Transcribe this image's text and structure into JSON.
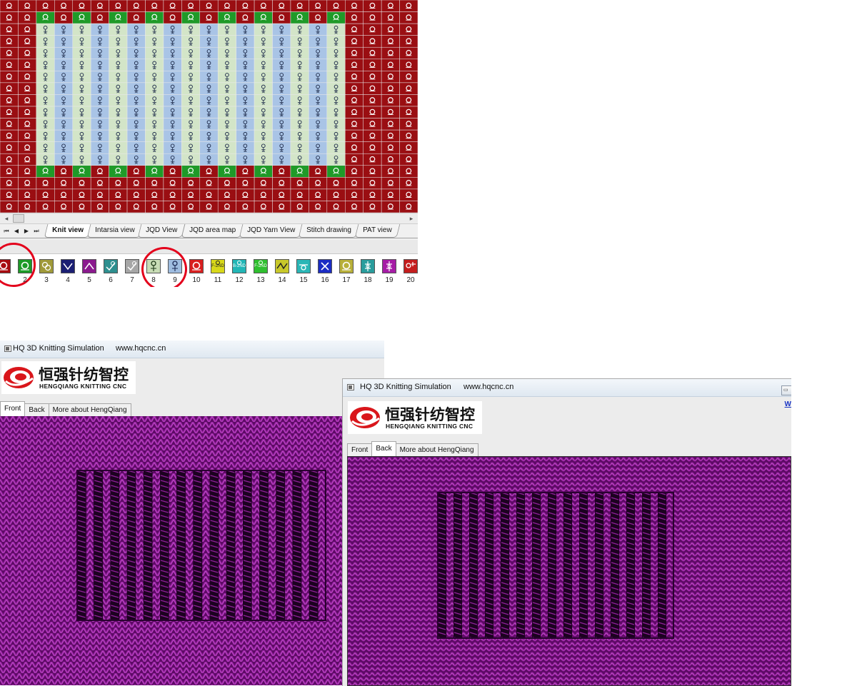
{
  "colors": {
    "red_bg": "#9a0e12",
    "green_bg": "#1f9a28",
    "lightgreen_col": "#d3e5c8",
    "lightblue_col": "#a9c4e6",
    "knit_purple": "#7a0f82",
    "ring_red": "#e3001b",
    "link_blue": "#1a35c4"
  },
  "pattern": {
    "cols": 23,
    "rows": 18,
    "inner_cols": 20,
    "inner_rows": 14,
    "icons": [
      "knit-loop-icon",
      "tuck-loop-icon",
      "transfer-icon"
    ]
  },
  "editor": {
    "sheet_nav": [
      "⏮",
      "◀",
      "▶",
      "⏭"
    ],
    "sheet_tabs": [
      {
        "label": "Knit view",
        "active": true
      },
      {
        "label": "Intarsia view",
        "active": false
      },
      {
        "label": "JQD View",
        "active": false
      },
      {
        "label": "JQD area map",
        "active": false
      },
      {
        "label": "JQD Yarn View",
        "active": false
      },
      {
        "label": "Stitch drawing",
        "active": false
      },
      {
        "label": "PAT view",
        "active": false
      }
    ],
    "palette": [
      {
        "num": "",
        "color": "#a80c10",
        "icon": "loop-knit-icon",
        "fg": "#ffffff",
        "circled": true
      },
      {
        "num": "2",
        "color": "#1d9a27",
        "icon": "loop-tuck-icon",
        "fg": "#ffffff",
        "circled": true
      },
      {
        "num": "3",
        "color": "#a09a3a",
        "icon": "double-loop-icon",
        "fg": "#ffffff",
        "circled": false
      },
      {
        "num": "4",
        "color": "#1b1f73",
        "icon": "v-stitch-icon",
        "fg": "#ffffff",
        "circled": false
      },
      {
        "num": "5",
        "color": "#8b1a8e",
        "icon": "caret-stitch-icon",
        "fg": "#ffffff",
        "circled": false
      },
      {
        "num": "6",
        "color": "#2e8f8f",
        "icon": "loop-up-icon",
        "fg": "#ffffff",
        "circled": false
      },
      {
        "num": "7",
        "color": "#a6a6a6",
        "icon": "tick-stitch-icon",
        "fg": "#ffffff",
        "circled": false
      },
      {
        "num": "8",
        "color": "#c8ddb6",
        "icon": "transfer-front-icon",
        "fg": "#1d3a18",
        "circled": true
      },
      {
        "num": "9",
        "color": "#9fbde0",
        "icon": "transfer-back-icon",
        "fg": "#1c2a55",
        "circled": true
      },
      {
        "num": "10",
        "color": "#d81f1f",
        "icon": "loop-red-icon",
        "fg": "#ffffff",
        "circled": false
      },
      {
        "num": "11",
        "color": "#d8d81a",
        "icon": "f2nd-icon",
        "fg": "#222222",
        "circled": false,
        "text": "F-2ND"
      },
      {
        "num": "12",
        "color": "#22b6b6",
        "icon": "b2nd-icon",
        "fg": "#ffffff",
        "circled": false,
        "text": "B-2ND"
      },
      {
        "num": "13",
        "color": "#2fbf2f",
        "icon": "f2nd-green-icon",
        "fg": "#ffffff",
        "circled": false,
        "text": "F-2ND"
      },
      {
        "num": "14",
        "color": "#c8c82a",
        "icon": "zigzag-icon",
        "fg": "#222222",
        "circled": false
      },
      {
        "num": "15",
        "color": "#2ab6b6",
        "icon": "tuck-bar-icon",
        "fg": "#ffffff",
        "circled": false
      },
      {
        "num": "16",
        "color": "#1b2cc4",
        "icon": "cross-icon",
        "fg": "#ffffff",
        "circled": false
      },
      {
        "num": "17",
        "color": "#b8b03a",
        "icon": "loop-olive-icon",
        "fg": "#ffffff",
        "circled": false
      },
      {
        "num": "18",
        "color": "#2a9d9d",
        "icon": "split-stitch-icon",
        "fg": "#ffffff",
        "circled": false
      },
      {
        "num": "19",
        "color": "#a61ca6",
        "icon": "split-magenta-icon",
        "fg": "#ffffff",
        "circled": false
      },
      {
        "num": "20",
        "color": "#c41d1d",
        "icon": "move-red-icon",
        "fg": "#ffffff",
        "circled": false
      }
    ]
  },
  "sim_front": {
    "title": "HQ 3D Knitting Simulation",
    "url": "www.hqcnc.cn",
    "logo_cn": "恒强针纺智控",
    "logo_en": "HENGQIANG KNITTING CNC",
    "tabs": [
      {
        "label": "Front",
        "active": true
      },
      {
        "label": "Back",
        "active": false
      },
      {
        "label": "More about HengQiang",
        "active": false
      }
    ],
    "ribs": 15
  },
  "sim_back": {
    "title": "HQ 3D Knitting Simulation",
    "url": "www.hqcnc.cn",
    "logo_cn": "恒强针纺智控",
    "logo_en": "HENGQIANG KNITTING CNC",
    "tabs": [
      {
        "label": "Front",
        "active": false
      },
      {
        "label": "Back",
        "active": true
      },
      {
        "label": "More about HengQiang",
        "active": false
      }
    ],
    "side_link": "W",
    "ribs": 15
  }
}
